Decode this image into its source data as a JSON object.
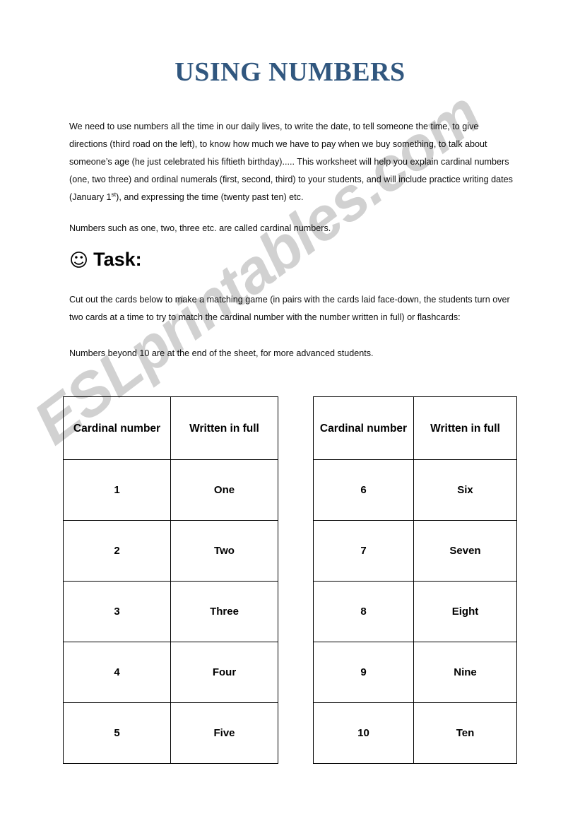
{
  "document": {
    "title": "USING NUMBERS",
    "title_color": "#31577f",
    "paragraphs": {
      "intro_part1": "We need to use numbers all the time in our daily lives, to write the date, to tell someone the time, to give directions (third road on the left), to know how much we have to pay when we buy something, to talk about someone’s age (he just celebrated his fiftieth birthday)..... This worksheet will help you explain cardinal numbers (one, two three) and ordinal numerals (first, second, third) to your students, and will include practice writing dates (January 1",
      "intro_superscript": "st",
      "intro_part2": "), and expressing the time (twenty past ten) etc.",
      "cardinal_definition": "Numbers such as one, two, three etc. are called cardinal numbers.",
      "task_instructions": "Cut out the cards below to make a matching game (in pairs with the cards laid face-down, the students turn over two cards at a time to try to match the cardinal number with the number written in full) or flashcards:",
      "beyond_ten_note": "Numbers beyond 10 are at the end of the sheet, for more advanced students."
    },
    "task_heading": {
      "icon": "smiley-face-icon",
      "icon_glyph": "☺",
      "label": "Task:"
    },
    "watermark": {
      "text": "ESLprintables.com",
      "color": "#c9c9c9"
    }
  },
  "tables": {
    "left": {
      "headers": [
        "Cardinal number",
        "Written in full"
      ],
      "rows": [
        {
          "number": "1",
          "word": "One"
        },
        {
          "number": "2",
          "word": "Two"
        },
        {
          "number": "3",
          "word": "Three"
        },
        {
          "number": "4",
          "word": "Four"
        },
        {
          "number": "5",
          "word": "Five"
        }
      ]
    },
    "right": {
      "headers": [
        "Cardinal number",
        "Written in full"
      ],
      "rows": [
        {
          "number": "6",
          "word": "Six"
        },
        {
          "number": "7",
          "word": "Seven"
        },
        {
          "number": "8",
          "word": "Eight"
        },
        {
          "number": "9",
          "word": "Nine"
        },
        {
          "number": "10",
          "word": "Ten"
        }
      ]
    }
  }
}
